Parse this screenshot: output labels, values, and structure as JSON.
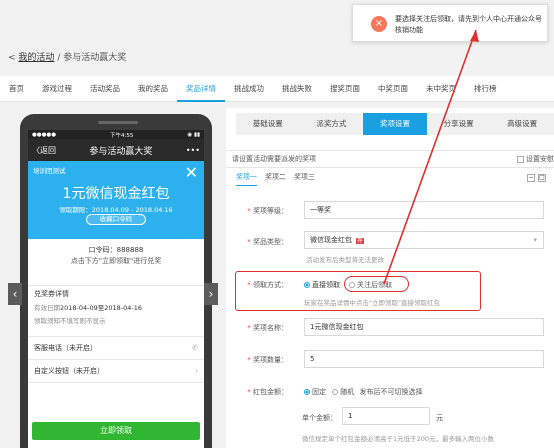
{
  "breadcrumb": {
    "link": "我的活动",
    "sep": "/",
    "current": "参与活动赢大奖",
    "back": "<"
  },
  "topnav": [
    "首页",
    "游戏过程",
    "活动奖品",
    "我的奖品",
    "奖品详情",
    "挑战成功",
    "挑战失败",
    "搜奖页面",
    "中奖页面",
    "未中奖页",
    "排行榜"
  ],
  "phone": {
    "status_left": "●●●●●",
    "status_time": "下午4:55",
    "status_right": "◉ ▮▮",
    "back": "〈返回",
    "title": "参与活动赢大奖",
    "more": "•••",
    "coupon_tag": "培训团测试",
    "coupon_title": "1元微信现金红包",
    "coupon_period": "领取期限：2018.04.09 - 2018.04.16",
    "coupon_btn": "收藏口令码",
    "code_line": "口令码：888888",
    "code_hint": "点击下方\"立即领取\"进行兑奖",
    "detail_title": "兑奖券详情",
    "detail_rows": [
      {
        "k": "有效日期",
        "v": "2018-04-09至2018-04-16"
      },
      {
        "k": "领取须知",
        "v": "不填写则不显示"
      }
    ],
    "service": "客服电话（未开启）",
    "custom": "自定义按钮（未开启）",
    "cta": "立即领取"
  },
  "tabs": [
    "基础设置",
    "派奖方式",
    "奖项设置",
    "分享设置",
    "高级设置"
  ],
  "desc": "请设置活动需要派发的奖项",
  "desc_right": "设置安慰",
  "subtabs": [
    "奖项一",
    "奖项二",
    "奖项三"
  ],
  "form": {
    "level_label": "奖项等级：",
    "level_value": "一等奖",
    "type_label": "奖品类型：",
    "type_value": "微信现金红包",
    "type_badge": "荐",
    "type_hint": "活动发布后类型将无法更改",
    "method_label": "领取方式：",
    "method_opt1": "直接领取",
    "method_opt2": "关注后领取",
    "method_hint": "玩家在奖品详情中点击\"立即领取\"直接领取红包",
    "name_label": "奖项名称：",
    "name_value": "1元微信现金红包",
    "qty_label": "奖项数量：",
    "qty_value": "5",
    "amount_label": "红包金额：",
    "amount_opt1": "固定",
    "amount_opt2": "随机",
    "amount_note": "发布后不可切换选择",
    "single_label": "单个金额：",
    "single_value": "1",
    "unit": "元",
    "bottom_hint": "微信规定单个红包金额必须高于1元低于200元，最多输入两位小数"
  },
  "toast": {
    "text": "要选择关注后领取，请先到个人中心开通公众号核销功能",
    "icon": "×"
  }
}
